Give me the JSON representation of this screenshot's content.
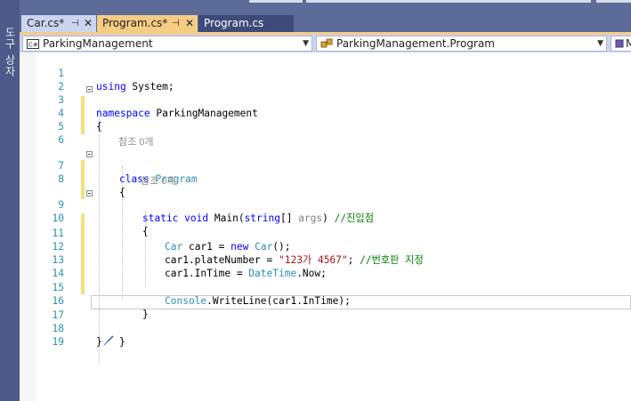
{
  "toolbox_label": "도구 상자",
  "tabs": [
    {
      "label": "Car.cs*",
      "pin": "⊣",
      "close": "✕"
    },
    {
      "label": "Program.cs*",
      "pin": "⊣",
      "close": "✕"
    },
    {
      "label": "Program.cs"
    }
  ],
  "navbar": {
    "project": "ParkingManagement",
    "type": "ParkingManagement.Program",
    "member": "M"
  },
  "code_lens": {
    "class_refs": "참조 0개",
    "method_refs": "참조 0개"
  },
  "line_numbers": [
    "1",
    "2",
    "3",
    "4",
    "5",
    "6",
    "7",
    "8",
    "9",
    "10",
    "11",
    "12",
    "13",
    "14",
    "15",
    "16",
    "17",
    "18",
    "19"
  ],
  "code": {
    "l1_kw": "using",
    "l1_rest": " System;",
    "l3_kw": "namespace",
    "l3_rest": " ParkingManagement",
    "l4": "{",
    "l7_kw": "class",
    "l7_type": "Program",
    "l8": "{",
    "l9_kw1": "static",
    "l9_kw2": "void",
    "l9_name": "Main(",
    "l9_kw3": "string",
    "l9_arr": "[] ",
    "l9_param": "args",
    "l9_close": ") ",
    "l9_comment": "//진입점",
    "l10": "{",
    "l11_type": "Car",
    "l11_mid": " car1 = ",
    "l11_kw": "new",
    "l11_type2": "Car",
    "l11_end": "();",
    "l12_start": "car1.plateNumber = ",
    "l12_str": "\"123가 4567\"",
    "l12_semi": "; ",
    "l12_comment": "//번호판 지정",
    "l13_start": "car1.InTime = ",
    "l13_type": "DateTime",
    "l13_end": ".Now;",
    "l15_type": "Console",
    "l15_rest": ".WriteLine(car1.InTime);",
    "l16": "}",
    "l17": "}",
    "l18": "}"
  },
  "colors": {
    "active_tab": "#f5cc84",
    "keyword": "#0000ff",
    "type": "#2b91af",
    "string": "#a31515",
    "comment": "#008000"
  }
}
